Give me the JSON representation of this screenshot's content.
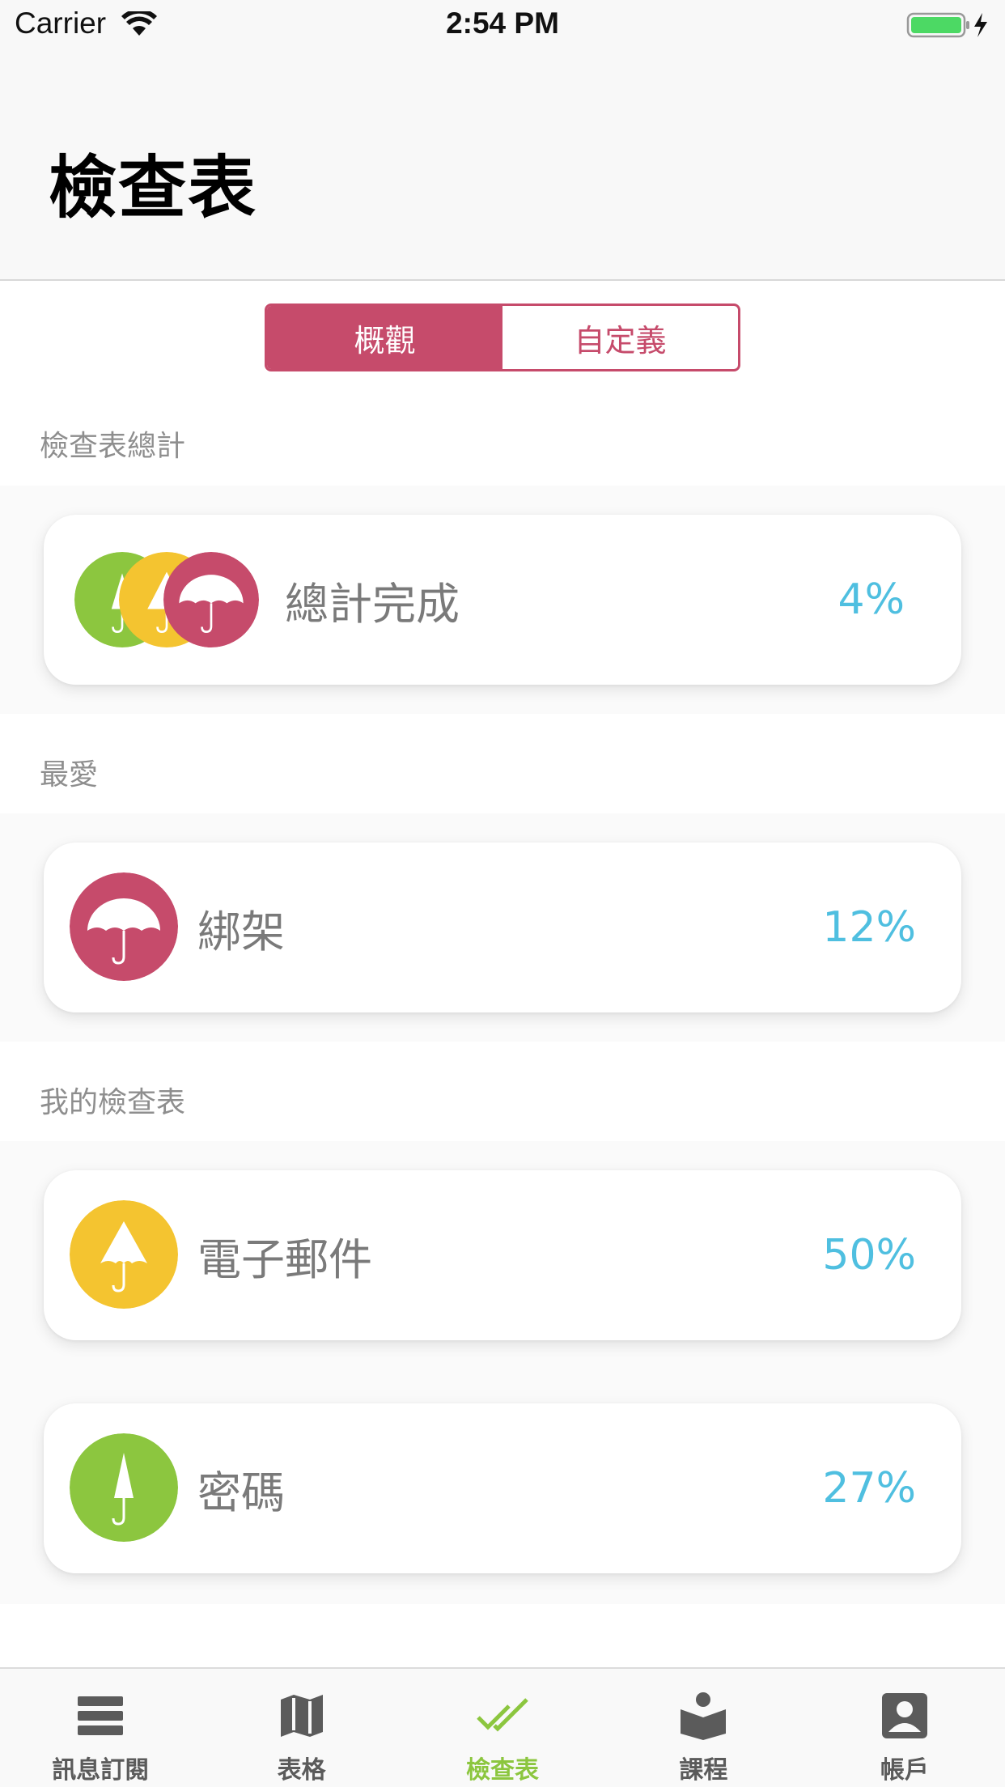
{
  "status_bar": {
    "carrier": "Carrier",
    "time": "2:54 PM"
  },
  "header": {
    "title": "檢查表"
  },
  "segmented_control": {
    "options": [
      "概觀",
      "自定義"
    ],
    "selected": "概觀"
  },
  "sections": {
    "summary": {
      "label": "檢查表總計",
      "card": {
        "name": "總計完成",
        "percent": "4%",
        "icon": "stacked-umbrella-icons"
      }
    },
    "favorites": {
      "label": "最愛",
      "card": {
        "name": "綁架",
        "percent": "12%",
        "icon": "open-umbrella-icon",
        "color": "#c64b6b"
      }
    },
    "my_checklists": {
      "label": "我的檢查表",
      "cards": [
        {
          "name": "電子郵件",
          "percent": "50%",
          "icon": "half-open-umbrella-icon",
          "color": "#f4c430"
        },
        {
          "name": "密碼",
          "percent": "27%",
          "icon": "closed-umbrella-icon",
          "color": "#8cc63f"
        }
      ]
    }
  },
  "tab_bar": {
    "items": [
      {
        "label": "訊息訂閱",
        "icon": "feed-icon"
      },
      {
        "label": "表格",
        "icon": "map-icon"
      },
      {
        "label": "檢查表",
        "icon": "double-check-icon",
        "active": true
      },
      {
        "label": "課程",
        "icon": "reader-icon"
      },
      {
        "label": "帳戶",
        "icon": "account-icon"
      }
    ]
  },
  "colors": {
    "accent": "#c64b6b",
    "percent": "#4fbfe0",
    "active_tab": "#8cc63f",
    "yellow": "#f4c430",
    "green": "#8cc63f"
  }
}
